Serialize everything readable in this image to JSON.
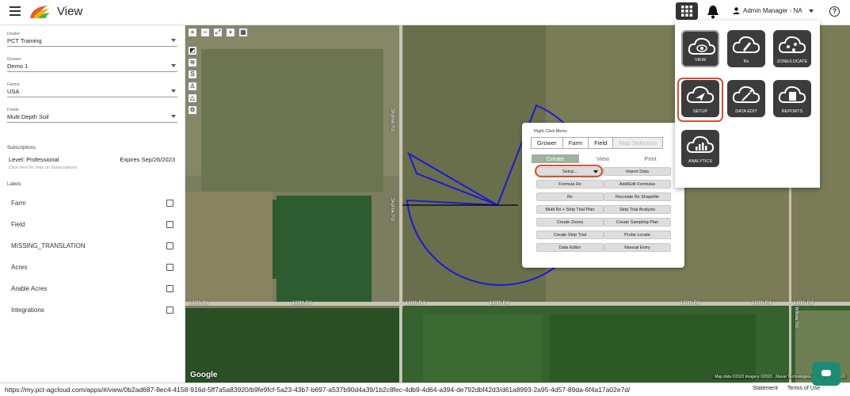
{
  "header": {
    "app_title": "View",
    "user_label": "Admin Manager - NA"
  },
  "sidebar": {
    "selectors": [
      {
        "label": "Dealer",
        "value": "PCT Training"
      },
      {
        "label": "Grower",
        "value": "Demo 1"
      },
      {
        "label": "Farms",
        "value": "USA"
      },
      {
        "label": "Fields",
        "value": "Multi Depth Soil"
      }
    ],
    "subscriptions": {
      "title": "Subscriptions",
      "level": "Level: Professional",
      "expires": "Expires Sep/26/2023",
      "help": "Click here for help on Subscriptions"
    },
    "labels_title": "Labels",
    "labels": [
      {
        "label": "Farm",
        "checked": false
      },
      {
        "label": "Field",
        "checked": false
      },
      {
        "label": "MISSING_TRANSLATION",
        "checked": false
      },
      {
        "label": "Acres",
        "checked": false
      },
      {
        "label": "Arable Acres",
        "checked": false
      },
      {
        "label": "Integrations",
        "checked": false
      }
    ]
  },
  "map": {
    "google": "Google",
    "credit": "Map data ©2023 Imagery ©2023 , Maxar Technologies, USDA/FPAC/GEO",
    "road_labels": {
      "r1": "160th Rd",
      "r2": "160th Rd",
      "r3": "160th Rd",
      "r4": "160th Rd",
      "r5": "160th Rd",
      "r6": "160th Rd",
      "r7": "160th Rd",
      "v1": "Skyline Rd",
      "v2": "Skyline Rd",
      "v3": "Willow Rd"
    }
  },
  "context_menu": {
    "title": "Right Click Menu",
    "tabs": [
      "Grower",
      "Farm",
      "Field",
      "Map Selection"
    ],
    "subtabs": [
      "Create",
      "View",
      "Print"
    ],
    "buttons": {
      "setup": "Setup...",
      "import_data": "Import Data",
      "formula_rx": "Formula Rx",
      "add_edit_formulas": "Add/Edit Formulas",
      "rx": "Rx",
      "recreate_rx_shapefile": "Recreate Rx Shapefile",
      "multi_rx": "Multi Rx + Strip Trial Plan",
      "strip_trial_analysis": "Strip Trial Analysis",
      "create_zones": "Create Zones",
      "create_sampling_plan": "Create Sampling Plan",
      "create_strip_trial": "Create Strip Trial",
      "probe_locate": "Probe Locate",
      "data_editor": "Data Editor",
      "manual_entry": "Manual Entry"
    }
  },
  "launcher": {
    "apps": [
      "VIEW",
      "Rx",
      "ZONE/LOCATE",
      "SETUP",
      "DATA EDIT",
      "REPORTS",
      "ANALYTICS"
    ]
  },
  "footer": {
    "url": "https://my.pct-agcloud.com/apps/#/view/0b2ad687-8ec4-4158-916d-5ff7a5a83920/b9fe9fcf-5a23-43b7-b697-a537b90d4a39/1b2c8fec-4db9-4d64-a394-de792dbf42d3/d61a8993-2a95-4d57-89da-6f4a17a02e7d/",
    "statement": "Statement",
    "terms": "Terms of Use"
  },
  "colors": {
    "accent_red": "#e04a2e",
    "field_boundary": "#1a1adb",
    "chat": "#1d8b74"
  }
}
